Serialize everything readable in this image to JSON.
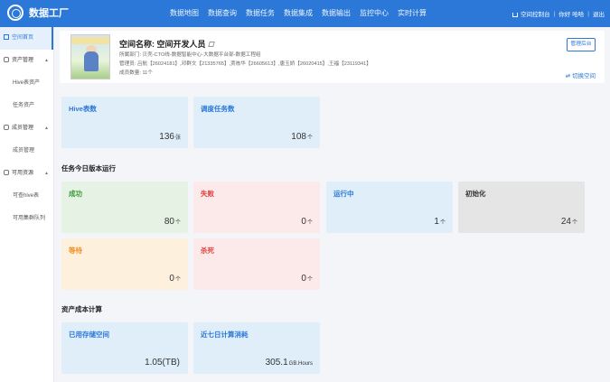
{
  "app": {
    "name": "数据工厂"
  },
  "nav": [
    "数据地图",
    "数据查询",
    "数据任务",
    "数据集成",
    "数据输出",
    "监控中心",
    "实时计算"
  ],
  "topright": {
    "console": "空间控制台",
    "greeting": "你好",
    "divider1": "|",
    "user": "哈哈",
    "divider2": "|",
    "tail": "退出"
  },
  "sidebar": [
    {
      "label": "空间首页",
      "type": "active"
    },
    {
      "label": "资产管理",
      "type": "group",
      "arrow": "▲"
    },
    {
      "label": "Hive表资产",
      "type": "sub"
    },
    {
      "label": "任务资产",
      "type": "sub"
    },
    {
      "label": "成员管理",
      "type": "group",
      "arrow": "▲"
    },
    {
      "label": "成员管理",
      "type": "sub"
    },
    {
      "label": "可用资源",
      "type": "group",
      "arrow": "▲"
    },
    {
      "label": "可查hive表",
      "type": "sub"
    },
    {
      "label": "可用集群队列",
      "type": "sub"
    }
  ],
  "space": {
    "title": "空间名称: 空间开发人员",
    "dept": "所属部门: 贝壳-CTO线-数据智能中心-大数据平台部-数据工程组",
    "managers": "管理员: 吕航【26024181】,邓群文【21335765】,贾栋华【26605613】,唐玉娇【26020415】,王福【23119341】",
    "members": "成员数量: 11个",
    "manage_btn": "管理后台",
    "switch_btn": "切换空间"
  },
  "assets": [
    {
      "title": "Hive表数",
      "value": "136",
      "unit": "张"
    },
    {
      "title": "调度任务数",
      "value": "108",
      "unit": "个"
    }
  ],
  "run_section": "任务今日版本运行",
  "runs": [
    {
      "title": "成功",
      "value": "80",
      "unit": "个"
    },
    {
      "title": "失败",
      "value": "0",
      "unit": "个"
    },
    {
      "title": "运行中",
      "value": "1",
      "unit": "个"
    },
    {
      "title": "初始化",
      "value": "24",
      "unit": "个"
    },
    {
      "title": "等待",
      "value": "0",
      "unit": "个"
    },
    {
      "title": "杀死",
      "value": "0",
      "unit": "个"
    }
  ],
  "cost_section": "资产成本计算",
  "costs": [
    {
      "title": "已用存储空间",
      "value": "1.05(TB)",
      "unit": ""
    },
    {
      "title": "近七日计算消耗",
      "value": "305.1",
      "unit": "GB.Hours"
    }
  ],
  "colors": {
    "primary": "#2b78d8",
    "success": "#3a9b3c",
    "fail": "#e0423a",
    "wait": "#f08c1a"
  }
}
